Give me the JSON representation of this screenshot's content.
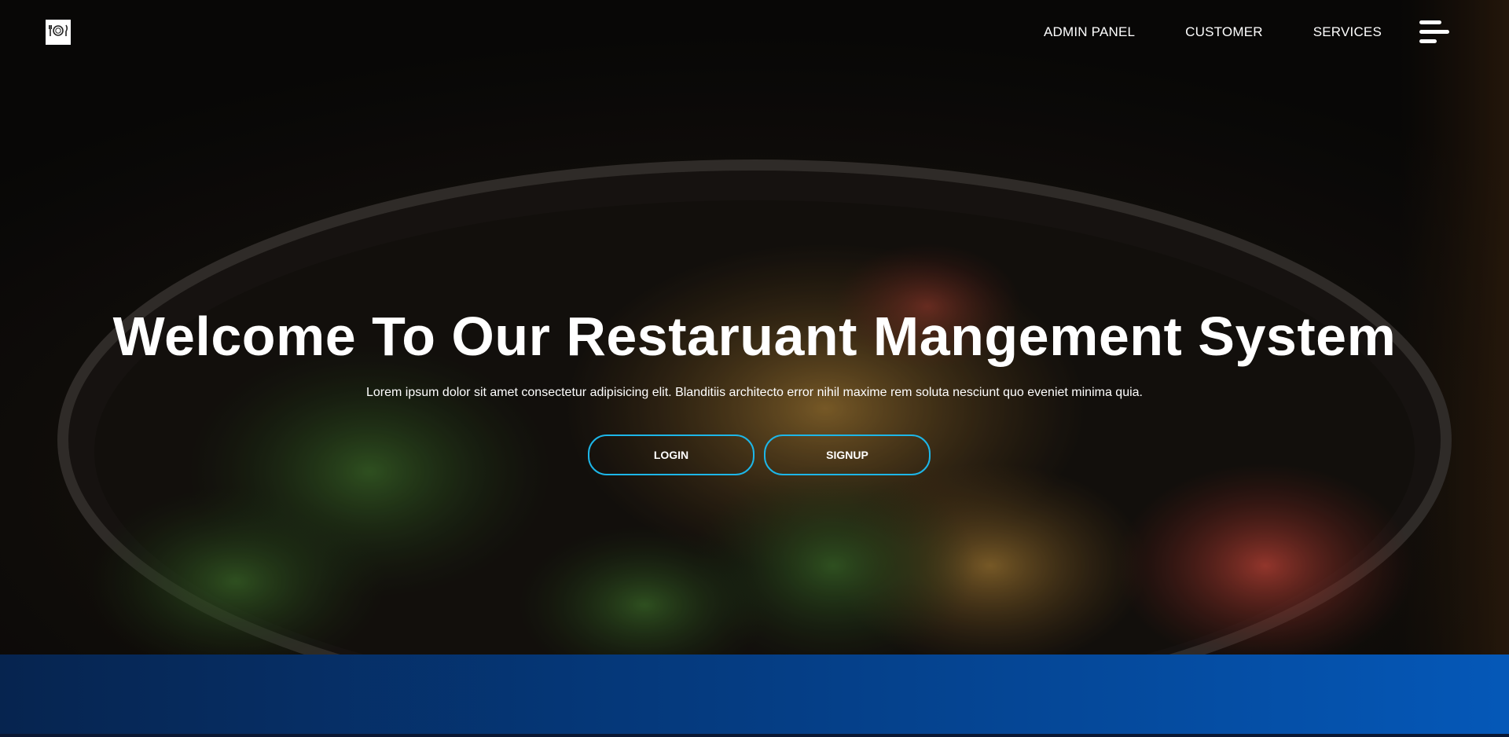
{
  "nav": {
    "logo_icon": "plate-cutlery-icon",
    "links": [
      "ADMIN PANEL",
      "CUSTOMER",
      "SERVICES"
    ],
    "menu_icon": "hamburger-menu-icon"
  },
  "hero": {
    "title": "Welcome To Our Restaruant Mangement System",
    "subtitle": "Lorem ipsum dolor sit amet consectetur adipisicing elit. Blanditiis architecto error nihil maxime rem soluta nesciunt quo eveniet minima quia.",
    "login_label": "LOGIN",
    "signup_label": "SIGNUP",
    "background": "food-bowl-photo"
  },
  "colors": {
    "button_border": "#1db6e8",
    "band_start": "#06244f",
    "band_end": "#0558b8"
  }
}
